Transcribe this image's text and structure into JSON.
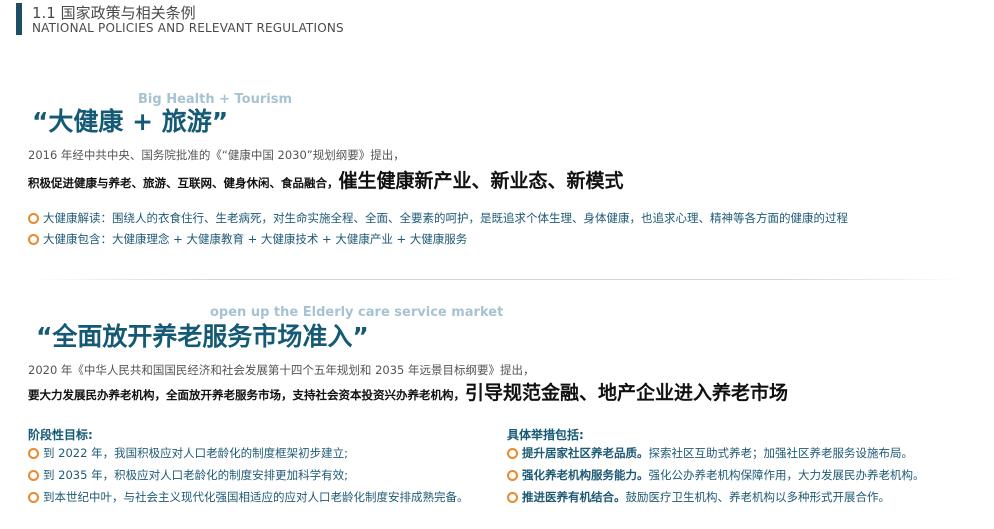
{
  "header": {
    "title": "1.1 国家政策与相关条例",
    "subtitle": "NATIONAL POLICIES AND RELEVANT REGULATIONS"
  },
  "section1": {
    "en_watermark": "Big Health + Tourism",
    "title": "“大健康 + 旅游”",
    "intro": "2016 年经中共中央、国务院批准的《“健康中国 2030”规划纲要》提出，",
    "emph_small": "积极促进健康与养老、旅游、互联网、健身休闲、食品融合，",
    "emph_big": "催生健康新产业、新业态、新模式",
    "bullets": [
      "大健康解读：围绕人的衣食住行、生老病死，对生命实施全程、全面、全要素的呵护，是既追求个体生理、身体健康，也追求心理、精神等各方面的健康的过程",
      "大健康包含：大健康理念 + 大健康教育 + 大健康技术 + 大健康产业 + 大健康服务"
    ]
  },
  "section2": {
    "en_watermark": "open up the Elderly care service market",
    "title": "“全面放开养老服务市场准入”",
    "intro": "2020 年《中华人民共和国国民经济和社会发展第十四个五年规划和 2035 年远景目标纲要》提出，",
    "emph_small": "要大力发展民办养老机构，全面放开养老服务市场，支持社会资本投资兴办养老机构，",
    "emph_big": "引导规范金融、地产企业进入养老市场",
    "left": {
      "heading": "阶段性目标:",
      "items": [
        "到 2022 年，我国积极应对人口老龄化的制度框架初步建立;",
        "到 2035 年，积极应对人口老龄化的制度安排更加科学有效;",
        "到本世纪中叶，与社会主义现代化强国相适应的应对人口老龄化制度安排成熟完备。"
      ]
    },
    "right": {
      "heading": "具体举措包括:",
      "items": [
        {
          "strong": "提升居家社区养老品质。",
          "rest": "探索社区互助式养老；加强社区养老服务设施布局。"
        },
        {
          "strong": "强化养老机构服务能力。",
          "rest": "强化公办养老机构保障作用，大力发展民办养老机构。"
        },
        {
          "strong": "推进医养有机结合。",
          "rest": "鼓励医疗卫生机构、养老机构以多种形式开展合作。"
        }
      ]
    }
  },
  "colors": {
    "primary": "#155a75",
    "accent_bullet": "#e88a2d",
    "watermark": "#a7c3d1"
  }
}
